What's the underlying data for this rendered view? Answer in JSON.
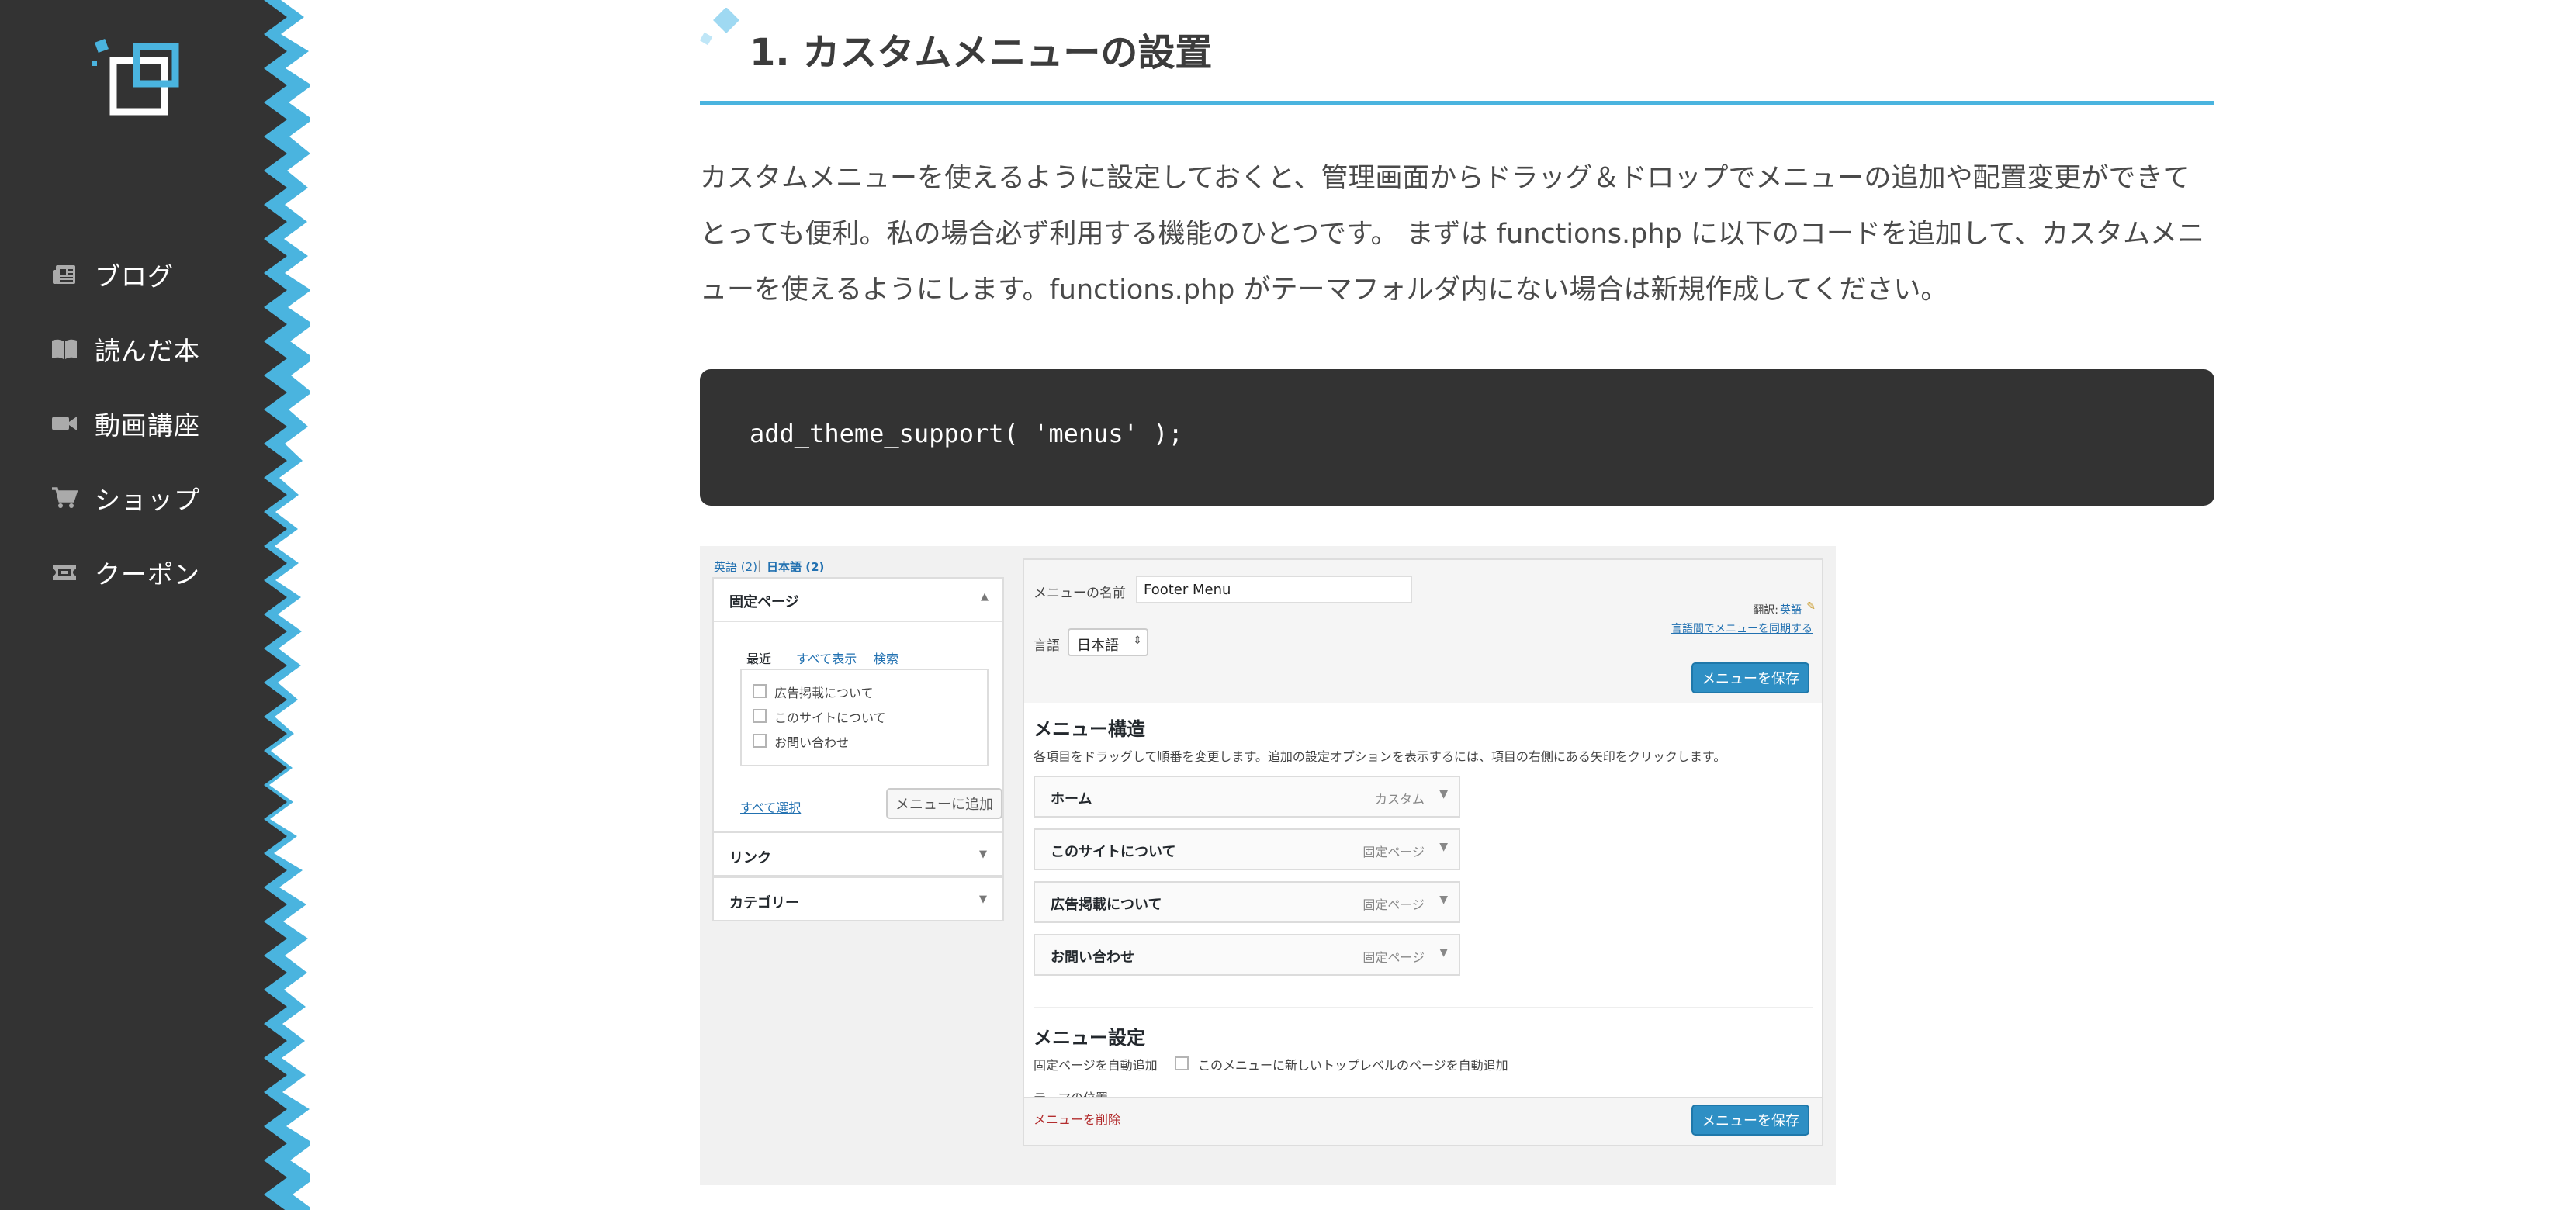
{
  "sidebar": {
    "logo_icon": "site-logo",
    "items": [
      {
        "label": "ブログ",
        "icon": "newspaper-icon"
      },
      {
        "label": "読んだ本",
        "icon": "book-icon"
      },
      {
        "label": "動画講座",
        "icon": "video-camera-icon"
      },
      {
        "label": "ショップ",
        "icon": "shopping-cart-icon"
      },
      {
        "label": "クーポン",
        "icon": "ticket-icon"
      }
    ],
    "colors": {
      "background": "#333333",
      "accent": "#4ab4df"
    }
  },
  "article": {
    "heading": "1. カスタムメニューの設置",
    "paragraph": "カスタムメニューを使えるように設定しておくと、管理画面からドラッグ＆ドロップでメニューの追加や配置変更ができてとっても便利。私の場合必ず利用する機能のひとつです。 まずは functions.php に以下のコードを追加して、カスタムメニューを使えるようにします。functions.php がテーマフォルダ内にない場合は新規作成してください。",
    "code": "add_theme_support( 'menus' );"
  },
  "screenshot": {
    "lang_tabs": {
      "en": "英語 (2)",
      "sep": "|",
      "ja": "日本語 (2)"
    },
    "pages_panel": {
      "title": "固定ページ",
      "tabs": [
        "最近",
        "すべて表示",
        "検索"
      ],
      "pages": [
        "広告掲載について",
        "このサイトについて",
        "お問い合わせ"
      ],
      "select_all": "すべて選択",
      "add_button": "メニューに追加"
    },
    "links_panel": "リンク",
    "categories_panel": "カテゴリー",
    "menu_name_label": "メニューの名前",
    "menu_name_value": "Footer Menu",
    "translation_label": "翻訳:",
    "translation_link": "英語",
    "sync_link": "言語間でメニューを同期する",
    "language_label": "言語",
    "language_value": "日本語",
    "save_button": "メニューを保存",
    "structure_title": "メニュー構造",
    "structure_desc": "各項目をドラッグして順番を変更します。追加の設定オプションを表示するには、項目の右側にある矢印をクリックします。",
    "menu_items": [
      {
        "name": "ホーム",
        "type": "カスタム"
      },
      {
        "name": "このサイトについて",
        "type": "固定ページ"
      },
      {
        "name": "広告掲載について",
        "type": "固定ページ"
      },
      {
        "name": "お問い合わせ",
        "type": "固定ページ"
      }
    ],
    "settings_title": "メニュー設定",
    "auto_add_label": "固定ページを自動追加",
    "auto_add_option": "このメニューに新しいトップレベルのページを自動追加",
    "theme_location_label": "テーマの位置",
    "delete_link": "メニューを削除"
  }
}
